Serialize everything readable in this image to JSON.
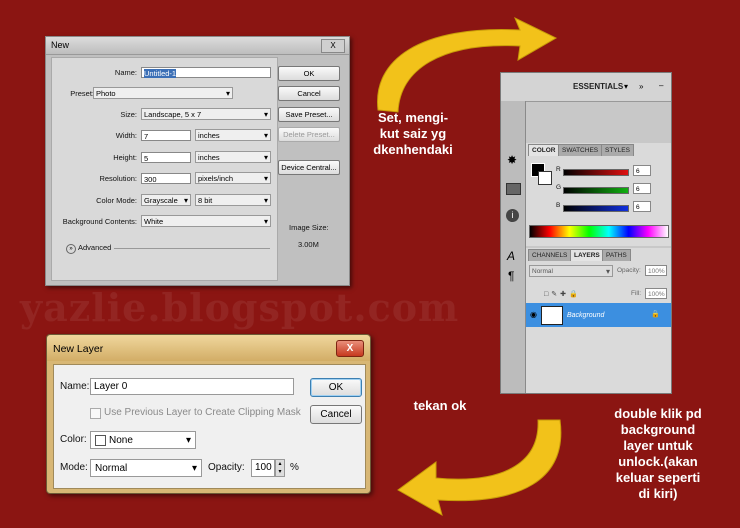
{
  "watermark": "yazlie.blogspot.com",
  "new_dialog": {
    "title": "New",
    "close": "X",
    "name_label": "Name:",
    "name_value": "Untitled-1",
    "preset_label": "Preset:",
    "preset_value": "Photo",
    "size_label": "Size:",
    "size_value": "Landscape, 5 x 7",
    "width_label": "Width:",
    "width_value": "7",
    "width_unit": "inches",
    "height_label": "Height:",
    "height_value": "5",
    "height_unit": "inches",
    "resolution_label": "Resolution:",
    "resolution_value": "300",
    "resolution_unit": "pixels/inch",
    "color_mode_label": "Color Mode:",
    "color_mode_value": "Grayscale",
    "bit_depth": "8 bit",
    "bg_label": "Background Contents:",
    "bg_value": "White",
    "advanced": "Advanced",
    "ok": "OK",
    "cancel": "Cancel",
    "save_preset": "Save Preset...",
    "delete_preset": "Delete Preset...",
    "device_central": "Device Central...",
    "image_size_label": "Image Size:",
    "image_size_value": "3.00M"
  },
  "layer_dialog": {
    "title": "New Layer",
    "close": "X",
    "name_label": "Name:",
    "name_value": "Layer 0",
    "clip_label": "Use Previous Layer to Create Clipping Mask",
    "color_label": "Color:",
    "color_value": "None",
    "mode_label": "Mode:",
    "mode_value": "Normal",
    "opacity_label": "Opacity:",
    "opacity_value": "100",
    "percent": "%",
    "ok": "OK",
    "cancel": "Cancel"
  },
  "panel": {
    "workspace": "ESSENTIALS",
    "color_tabs": [
      "COLOR",
      "SWATCHES",
      "STYLES"
    ],
    "sliders": [
      {
        "label": "R",
        "value": "6",
        "color": "#e01010"
      },
      {
        "label": "G",
        "value": "6",
        "color": "#10b010"
      },
      {
        "label": "B",
        "value": "6",
        "color": "#1030e0"
      }
    ],
    "layer_tabs": [
      "CHANNELS",
      "LAYERS",
      "PATHS"
    ],
    "blend_mode": "Normal",
    "opacity_label": "Opacity:",
    "opacity_value": "100%",
    "fill_label": "Fill:",
    "fill_value": "100%",
    "layer_name": "Background",
    "selected_color": "#3c8fe0"
  },
  "annotations": {
    "set_size": "Set, mengi-\nkut saiz yg\ndkenhendaki",
    "press_ok": "tekan ok",
    "double_click": "double klik pd\nbackground\nlayer untuk\nunlock.(akan\nkeluar seperti\ndi kiri)"
  },
  "colors": {
    "background": "#8b1512",
    "arrow": "#f2c21a"
  }
}
